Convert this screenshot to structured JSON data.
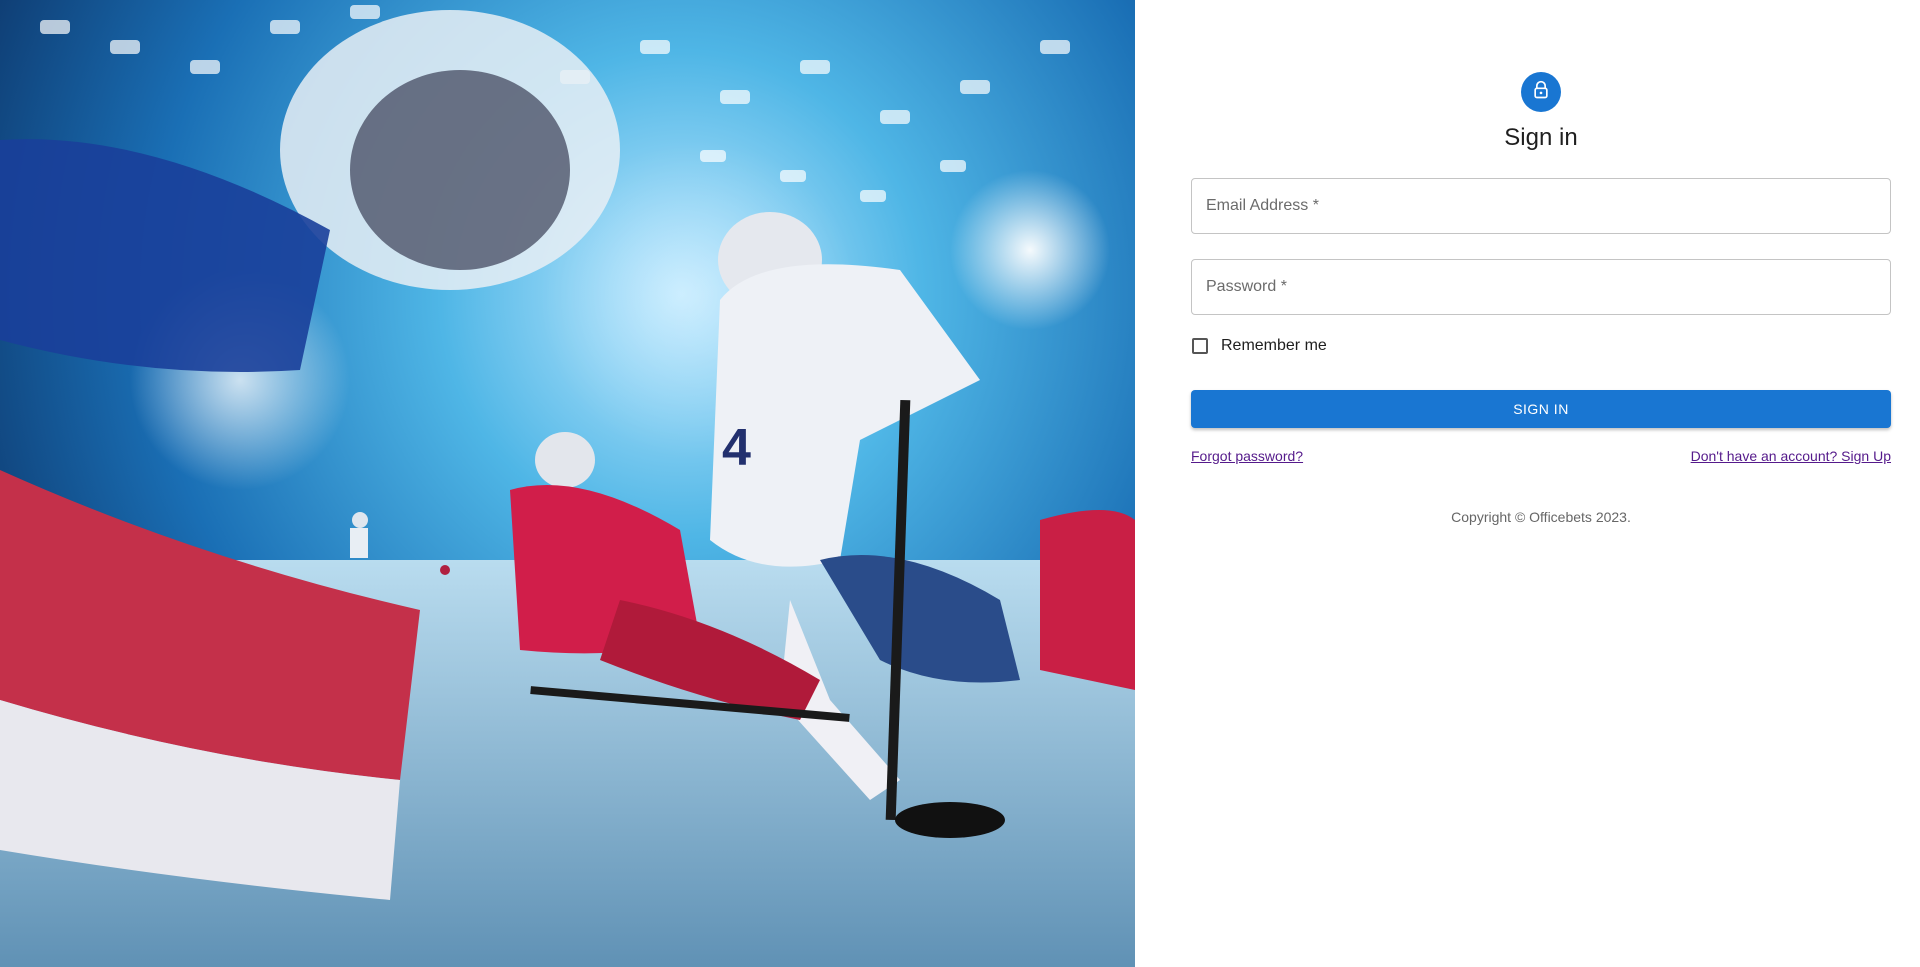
{
  "hero": {
    "image_name": "hockey-players-illustration",
    "jersey_number": "4"
  },
  "form": {
    "title": "Sign in",
    "lock_icon": "lock-icon",
    "email": {
      "placeholder": "Email Address *",
      "value": ""
    },
    "password": {
      "placeholder": "Password *",
      "value": ""
    },
    "remember_label": "Remember me",
    "remember_checked": false,
    "submit_label": "SIGN IN",
    "forgot_label": "Forgot password?",
    "signup_label": "Don't have an account? Sign Up",
    "copyright": "Copyright © Officebets 2023."
  },
  "colors": {
    "primary": "#1976d2",
    "link_visited": "#551a8b",
    "border": "#c4c4c4"
  }
}
